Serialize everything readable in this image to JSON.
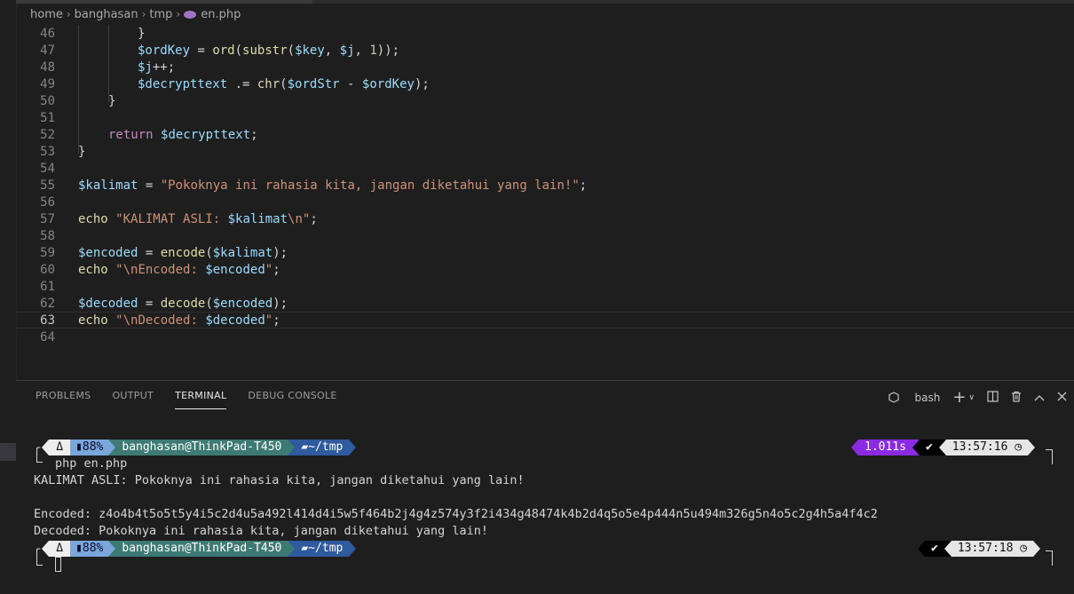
{
  "breadcrumb": {
    "parts": [
      "home",
      "banghasan",
      "tmp"
    ],
    "file": "en.php"
  },
  "editor": {
    "lines": [
      {
        "n": "46"
      },
      {
        "n": "47"
      },
      {
        "n": "48"
      },
      {
        "n": "49"
      },
      {
        "n": "50"
      },
      {
        "n": "51"
      },
      {
        "n": "52"
      },
      {
        "n": "53"
      },
      {
        "n": "54"
      },
      {
        "n": "55"
      },
      {
        "n": "56"
      },
      {
        "n": "57"
      },
      {
        "n": "58"
      },
      {
        "n": "59"
      },
      {
        "n": "60"
      },
      {
        "n": "61"
      },
      {
        "n": "62"
      },
      {
        "n": "63"
      },
      {
        "n": "64"
      }
    ],
    "current_line": "63",
    "code": {
      "l46": "}",
      "l47a": "$ordKey",
      "l47b": " = ",
      "l47c": "ord",
      "l47d": "(",
      "l47e": "substr",
      "l47f": "(",
      "l47g": "$key",
      "l47h": ", ",
      "l47i": "$j",
      "l47j": ", ",
      "l47k": "1",
      "l47l": "));",
      "l48a": "$j",
      "l48b": "++;",
      "l49a": "$decrypttext",
      "l49b": " .= ",
      "l49c": "chr",
      "l49d": "(",
      "l49e": "$ordStr",
      "l49f": " - ",
      "l49g": "$ordKey",
      "l49h": ");",
      "l50": "}",
      "l52a": "return",
      "l52b": " ",
      "l52c": "$decrypttext",
      "l52d": ";",
      "l53": "}",
      "l55a": "$kalimat",
      "l55b": " = ",
      "l55c": "\"Pokoknya ini rahasia kita, jangan diketahui yang lain!\"",
      "l55d": ";",
      "l57a": "echo",
      "l57b": " ",
      "l57c": "\"KALIMAT ASLI: ",
      "l57d": "$kalimat",
      "l57e": "\\n",
      "l57f": "\"",
      "l57g": ";",
      "l59a": "$encoded",
      "l59b": " = ",
      "l59c": "encode",
      "l59d": "(",
      "l59e": "$kalimat",
      "l59f": ");",
      "l60a": "echo",
      "l60b": " ",
      "l60c": "\"",
      "l60d": "\\n",
      "l60e": "Encoded: ",
      "l60f": "$encoded",
      "l60g": "\"",
      "l60h": ";",
      "l62a": "$decoded",
      "l62b": " = ",
      "l62c": "decode",
      "l62d": "(",
      "l62e": "$encoded",
      "l62f": ");",
      "l63a": "echo",
      "l63b": " ",
      "l63c": "\"",
      "l63d": "\\n",
      "l63e": "Decoded: ",
      "l63f": "$decoded",
      "l63g": "\"",
      "l63h": ";"
    }
  },
  "panel": {
    "tabs": [
      "PROBLEMS",
      "OUTPUT",
      "TERMINAL",
      "DEBUG CONSOLE"
    ],
    "active_tab": "TERMINAL",
    "shell": "bash"
  },
  "terminal": {
    "prompt1": {
      "os": "Δ",
      "battery": "88%",
      "user": "banghasan@ThinkPad-T450",
      "dir": "~/tmp",
      "duration": "1.011s",
      "status": "✔",
      "time": "13:57:16"
    },
    "command": "php en.php",
    "output": [
      "KALIMAT ASLI: Pokoknya ini rahasia kita, jangan diketahui yang lain!",
      "",
      "Encoded: z4o4b4t5o5t5y4i5c2d4u5a492l414d4i5w5f464b2j4g4z574y3f2i434g48474k4b2d4q5o5e4p444n5u494m326g5n4o5c2g4h5a4f4c2",
      "Decoded: Pokoknya ini rahasia kita, jangan diketahui yang lain!"
    ],
    "prompt2": {
      "os": "Δ",
      "battery": "88%",
      "user": "banghasan@ThinkPad-T450",
      "dir": "~/tmp",
      "status": "✔",
      "time": "13:57:18"
    }
  },
  "colors": {
    "bg": "#1e1e1e",
    "accent_user": "#3d7a73",
    "accent_dir": "#2e5a9e",
    "duration": "#8a2be2"
  }
}
